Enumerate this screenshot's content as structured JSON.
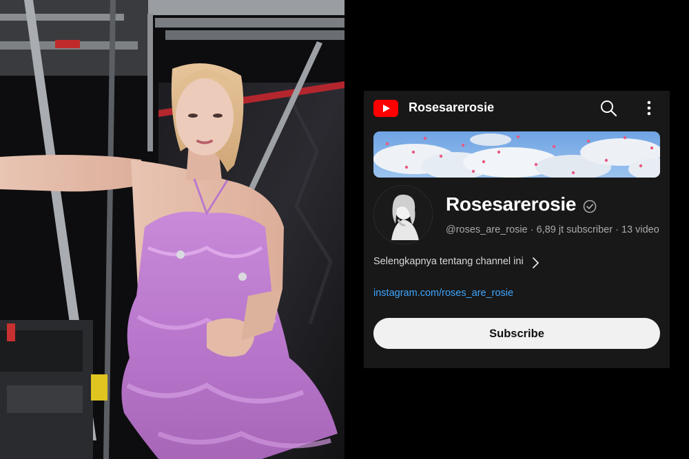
{
  "header": {
    "app_icon": "youtube-logo-icon",
    "title": "Rosesarerosie",
    "actions": [
      "search-icon",
      "more-vertical-icon"
    ]
  },
  "channel": {
    "name": "Rosesarerosie",
    "verified_icon": "verified-check-icon",
    "handle": "@roses_are_rosie",
    "subscribers": "6,89 jt subscriber",
    "videos": "13 video",
    "separator": "·",
    "about_label": "Selengkapnya tentang channel ini",
    "link": "instagram.com/roses_are_rosie",
    "subscribe_label": "Subscribe"
  },
  "colors": {
    "panel_bg": "#181818",
    "youtube_red": "#ff0000",
    "link_blue": "#3ea6ff",
    "subscribe_bg": "#f1f1f1"
  }
}
